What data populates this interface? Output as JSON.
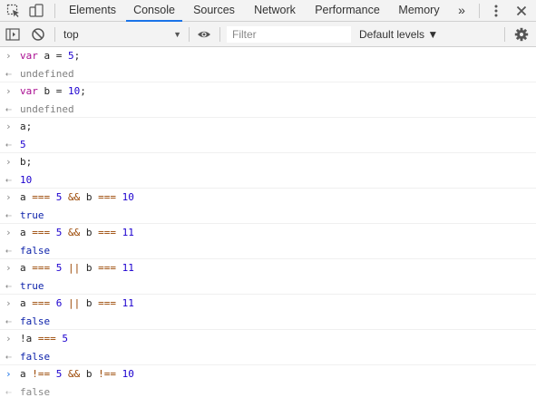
{
  "tabs": {
    "items": [
      "Elements",
      "Console",
      "Sources",
      "Network",
      "Performance",
      "Memory"
    ],
    "active": "Console",
    "more": "»"
  },
  "console_toolbar": {
    "context": "top",
    "filter_placeholder": "Filter",
    "levels": "Default levels ▼"
  },
  "entries": [
    {
      "input": [
        "var",
        " a = ",
        "5",
        ";"
      ],
      "result": "undefined",
      "result_type": "undefined"
    },
    {
      "input": [
        "var",
        " b = ",
        "10",
        ";"
      ],
      "result": "undefined",
      "result_type": "undefined"
    },
    {
      "input": [
        "a;"
      ],
      "result": "5",
      "result_type": "number"
    },
    {
      "input": [
        "b;"
      ],
      "result": "10",
      "result_type": "number"
    },
    {
      "input": [
        "a ",
        "===",
        " ",
        "5",
        " ",
        "&&",
        " b ",
        "===",
        " ",
        "10"
      ],
      "result": "true",
      "result_type": "boolean"
    },
    {
      "input": [
        "a ",
        "===",
        " ",
        "5",
        " ",
        "&&",
        " b ",
        "===",
        " ",
        "11"
      ],
      "result": "false",
      "result_type": "boolean"
    },
    {
      "input": [
        "a ",
        "===",
        " ",
        "5",
        " ",
        "||",
        " b ",
        "===",
        " ",
        "11"
      ],
      "result": "true",
      "result_type": "boolean"
    },
    {
      "input": [
        "a ",
        "===",
        " ",
        "6",
        " ",
        "||",
        " b ",
        "===",
        " ",
        "11"
      ],
      "result": "false",
      "result_type": "boolean"
    },
    {
      "input": [
        "!a ",
        "===",
        " ",
        "5"
      ],
      "result": "false",
      "result_type": "boolean"
    }
  ],
  "current_input": {
    "text": "a !== 5 && b !== 10",
    "eager_result": "false"
  },
  "colors": {
    "keyword": "#aa0d91",
    "number": "#1c00cf",
    "operator": "#994500",
    "accent": "#1a73e8"
  }
}
